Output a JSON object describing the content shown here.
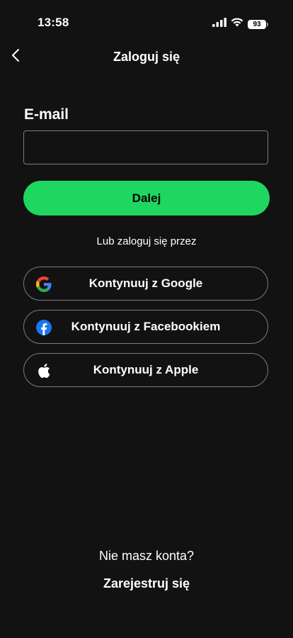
{
  "status_bar": {
    "time": "13:58",
    "battery": "93"
  },
  "nav": {
    "title": "Zaloguj się"
  },
  "form": {
    "email_label": "E-mail",
    "email_value": "",
    "next_label": "Dalej",
    "accent_color": "#1ed760"
  },
  "alt_login": {
    "divider": "Lub zaloguj się przez",
    "google_label": "Kontynuuj z Google",
    "facebook_label": "Kontynuuj z Facebookiem",
    "apple_label": "Kontynuuj z Apple"
  },
  "footer": {
    "no_account": "Nie masz konta?",
    "register": "Zarejestruj się"
  }
}
